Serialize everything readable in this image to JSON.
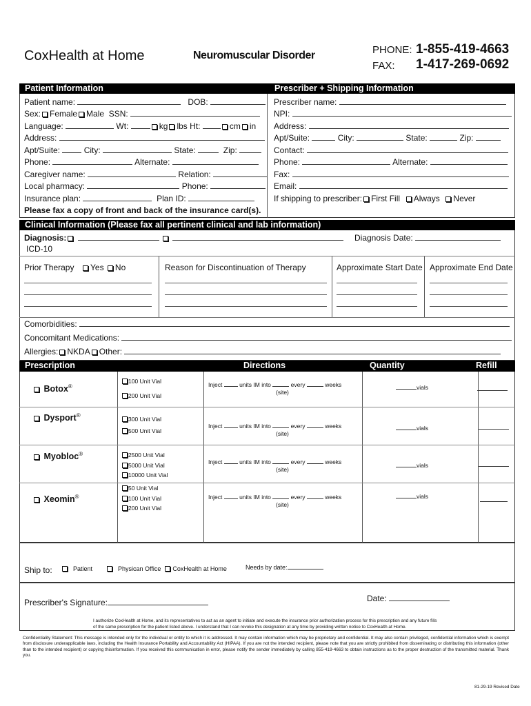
{
  "header": {
    "brand": "CoxHealth at Home",
    "form_title": "Neuromuscular Disorder",
    "phone_label": "PHONE:",
    "phone": "1-855-419-4663",
    "fax_label": "FAX:",
    "fax": "1-417-269-0692"
  },
  "patient": {
    "title": "Patient Information",
    "name": "Patient name:",
    "dob": "DOB:",
    "sex": "Sex:",
    "female": "Female",
    "male": "Male",
    "ssn": "SSN:",
    "language": "Language:",
    "wt": "Wt:",
    "kg": "kg",
    "lbs": "lbs",
    "ht": "Ht:",
    "cm": "cm",
    "in": "in",
    "address": "Address:",
    "apt": "Apt/Suite:",
    "city": "City:",
    "state": "State:",
    "zip": "Zip:",
    "phone": "Phone:",
    "alternate": "Alternate:",
    "caregiver": "Caregiver name:",
    "relation": "Relation:",
    "pharmacy": "Local pharmacy:",
    "pharmacy_phone": "Phone:",
    "insurance": "Insurance plan:",
    "plan_id": "Plan ID:",
    "note": "Please fax a copy of front and back of the insurance card(s)."
  },
  "prescriber": {
    "title": "Prescriber + Shipping Information",
    "name": "Prescriber name:",
    "npi": "NPI:",
    "address": "Address:",
    "apt": "Apt/Suite:",
    "city": "City:",
    "state": "State:",
    "zip": "Zip:",
    "contact": "Contact:",
    "phone": "Phone:",
    "alternate": "Alternate:",
    "fax": "Fax:",
    "email": "Email:",
    "shipping": "If shipping to prescriber:",
    "first_fill": "First Fill",
    "always": "Always",
    "never": "Never"
  },
  "clinical": {
    "title": "Clinical Information (Please fax all pertinent clinical and lab information)",
    "diagnosis": "Diagnosis:",
    "diagnosis_date": "Diagnosis Date:",
    "icd": "ICD-10",
    "prior_therapy": "Prior Therapy",
    "yes": "Yes",
    "no": "No",
    "reason": "Reason for Discontinuation of Therapy",
    "start": "Approximate Start Date",
    "end": "Approximate End Date",
    "comorbidities": "Comorbidities:",
    "concomitant": "Concomitant Medications:",
    "allergies": "Allergies:",
    "nkda": "NKDA",
    "other": "Other:"
  },
  "prescription": {
    "headers": {
      "prescription": "Prescription",
      "directions": "Directions",
      "quantity": "Quantity",
      "refill": "Refill"
    },
    "inject": "Inject",
    "units": "units IM into",
    "every": "every",
    "weeks": "weeks",
    "site": "(site)",
    "vials": "vials",
    "drugs": [
      {
        "name": "Botox",
        "mark": "®",
        "options": [
          "100 Unit Vial",
          "200 Unit Vial"
        ]
      },
      {
        "name": "Dysport",
        "mark": "®",
        "options": [
          "300 Unit Vial",
          "500 Unit Vial"
        ]
      },
      {
        "name": "Myobloc",
        "mark": "®",
        "options": [
          "2500 Unit Vial",
          "5000 Unit Vial",
          "10000 Unit Vial"
        ]
      },
      {
        "name": "Xeomin",
        "mark": "®",
        "options": [
          "50 Unit Vial",
          "100 Unit Vial",
          "200 Unit Vial"
        ]
      }
    ]
  },
  "ship": {
    "label": "Ship to:",
    "patient": "Patient",
    "office": "Physican Office",
    "home": "CoxHealth at Home",
    "needs_by": "Needs by date:"
  },
  "signature": {
    "label": "Prescriber's Signature:",
    "date": "Date:",
    "authorization": "I authorize CoxHealth at Home, and its representatives to act as an agent to initiate and execute the insurance prior authorization process for this prescription and any future fills of the same prescription for the patient listed above.  I understand that I can revoke this designation at any time by providing written notice to CoxHealth at Home."
  },
  "confidentiality": "Confidentiality Statement: This message is intended only for the individual or entity to which it is addressed. It may contain information which may be proprietary and confidential. It may also contain privileged, confidential information which is exempt from disclosure underapplicable laws, including the Health Insurance Portability and Accountability Act (HIPAA). If you are not the intended recipient, please note that you are strictly prohibited from disseminating or distributing this information (other than to the intended recipient) or copying thisinformation. If you received this communication in error, please notify the sender immediately by calling 855-419-4663 to obtain instructions as to the proper destruction of the transmitted material. Thank you.",
  "revised": "81-29-19 Revised Date"
}
